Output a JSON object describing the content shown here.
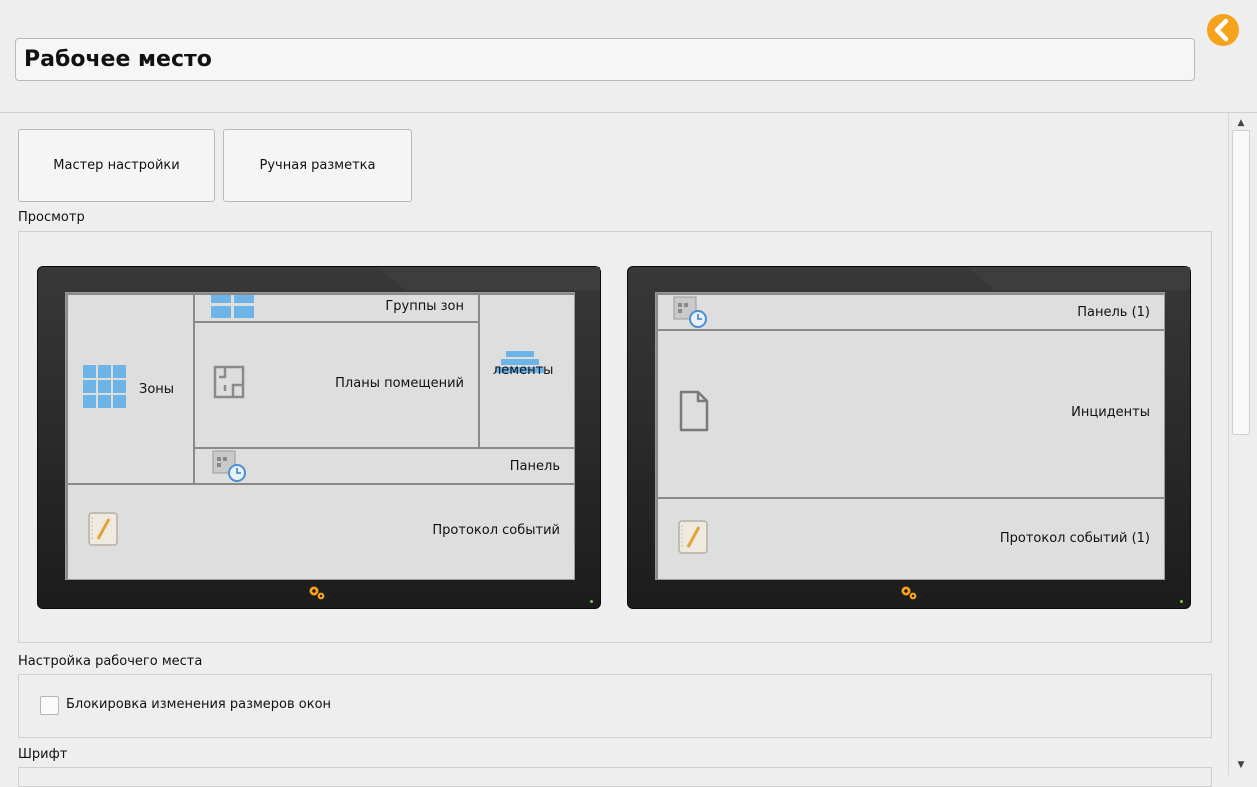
{
  "header": {
    "title": "Рабочее место"
  },
  "toolbar": {
    "wizard_label": "Мастер настройки",
    "manual_label": "Ручная разметка"
  },
  "preview": {
    "label": "Просмотр",
    "monitor1": {
      "zones": "Зоны",
      "zone_groups": "Группы зон",
      "floor_plans": "Планы помещений",
      "elements": "лементы",
      "panel": "Панель",
      "event_log": "Протокол событий"
    },
    "monitor2": {
      "panel": "Панель (1)",
      "incidents": "Инциденты",
      "event_log": "Протокол событий (1)"
    }
  },
  "workplace": {
    "label": "Настройка рабочего места",
    "lock_label": "Блокировка изменения размеров окон",
    "lock_checked": false
  },
  "font": {
    "label": "Шрифт"
  },
  "colors": {
    "accent": "#f7a21b",
    "icon_blue": "#6fb4e8",
    "screen_bg": "#dcdcdc"
  }
}
